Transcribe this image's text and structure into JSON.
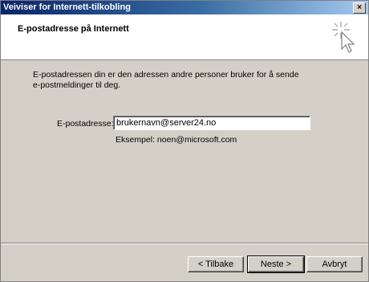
{
  "window": {
    "title": "Veiviser for Internett-tilkobling",
    "close_label": "×"
  },
  "header": {
    "title": "E-postadresse på Internett",
    "icon": "wizard-sparkle-cursor-icon"
  },
  "intro": {
    "line1": "E-postadressen din er den adressen andre personer bruker for å sende",
    "line2": "e-postmeldinger til deg."
  },
  "email": {
    "label": "E-postadresse:",
    "value": "brukernavn@server24.no",
    "example": "Eksempel: noen@microsoft.com"
  },
  "buttons": {
    "back": "< Tilbake",
    "next": "Neste >",
    "cancel": "Avbryt"
  },
  "colors": {
    "titlebar_start": "#0a246a",
    "titlebar_end": "#a6caf0",
    "face": "#d4d0c8"
  }
}
